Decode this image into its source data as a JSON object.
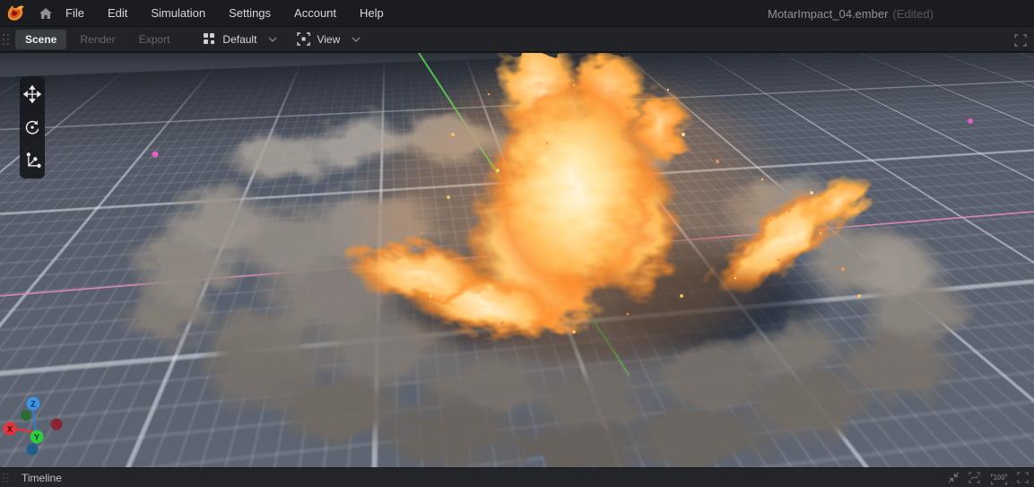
{
  "topbar": {
    "menus": [
      "File",
      "Edit",
      "Simulation",
      "Settings",
      "Account",
      "Help"
    ],
    "title": "MotarImpact_04.ember",
    "title_suffix": "(Edited)"
  },
  "toolbar": {
    "tabs": [
      {
        "label": "Scene",
        "active": true
      },
      {
        "label": "Render",
        "active": false
      },
      {
        "label": "Export",
        "active": false
      }
    ],
    "preset_dropdown": {
      "label": "Default"
    },
    "view_dropdown": {
      "label": "View"
    }
  },
  "viewport": {
    "tools": [
      {
        "name": "move"
      },
      {
        "name": "rotate"
      },
      {
        "name": "scale"
      }
    ],
    "gizmo": {
      "x": "X",
      "y": "Y",
      "z": "Z"
    }
  },
  "timeline": {
    "label": "Timeline",
    "zoom_level": "100"
  },
  "icons": {
    "logo": "embergen-flame",
    "home": "house",
    "preset": "blocks-group",
    "view": "frame-target",
    "chevron": "chevron-down",
    "toolbar_expand": "fullscreen-corners",
    "timeline_collapse": "collapse-arrows",
    "timeline_curve": "curve-in-brackets",
    "timeline_zoom": "100-in-brackets",
    "timeline_fullscreen": "fullscreen-corners"
  },
  "colors": {
    "topbar_bg": "#1a1c20",
    "toolbar_bg": "#212327",
    "active_tab_bg": "#393c41",
    "ground": "#8b93a2",
    "grid_line": "#e4e9f0",
    "axis_line_pink": "#f08cc0",
    "axis_line_green": "#57d34f",
    "fire_core": "#fff6dd",
    "fire_orange": "#ff9335",
    "smoke_gray": "#847c74",
    "gizmo_x": "#e8323c",
    "gizmo_y": "#2ecc40",
    "gizmo_z": "#3b96e8"
  }
}
